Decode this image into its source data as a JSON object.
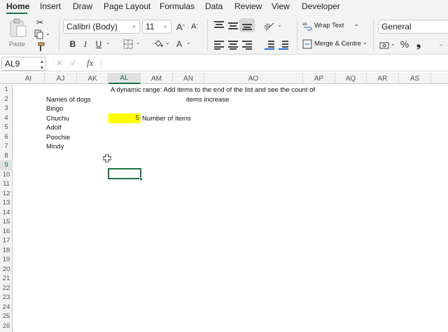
{
  "ribbon_tabs": [
    "Home",
    "Insert",
    "Draw",
    "Page Layout",
    "Formulas",
    "Data",
    "Review",
    "View",
    "Developer"
  ],
  "ribbon": {
    "paste_label": "Paste",
    "font_name": "Calibri (Body)",
    "font_size": "11",
    "grow_font": "A",
    "shrink_font": "A",
    "bold": "B",
    "italic": "I",
    "underline": "U",
    "font_color_letter": "A",
    "wrap_text": "Wrap Text",
    "merge_centre": "Merge & Centre",
    "number_format": "General",
    "percent": "%",
    "comma": "❟",
    "accent_color": "#1e7145"
  },
  "formula_bar": {
    "name_box": "AL9",
    "cancel_icon": "✕",
    "enter_icon": "✓",
    "fx_label": "fx",
    "content": ""
  },
  "columns": [
    "AI",
    "AJ",
    "AK",
    "AL",
    "AM",
    "AN",
    "AO",
    "AP",
    "AQ",
    "AR",
    "AS"
  ],
  "selected_column": "AL",
  "rows": [
    "1",
    "2",
    "3",
    "4",
    "5",
    "6",
    "7",
    "8",
    "9",
    "10",
    "11",
    "12",
    "13",
    "14",
    "15",
    "16",
    "17",
    "18",
    "19",
    "20",
    "21",
    "22",
    "23",
    "24",
    "25",
    "26"
  ],
  "selected_row": "9",
  "sheet": {
    "title_line1": "A dynamic range: Add items to the end of the list and see the count of",
    "title_line2": "items increase",
    "dogs_header": "Names of dogs",
    "dogs": [
      "Bingo",
      "Chuchu",
      "Adolf",
      "Poochie",
      "Mindy"
    ],
    "count_value": "5",
    "count_label": "Number of items",
    "highlight_color": "#ffff00"
  }
}
